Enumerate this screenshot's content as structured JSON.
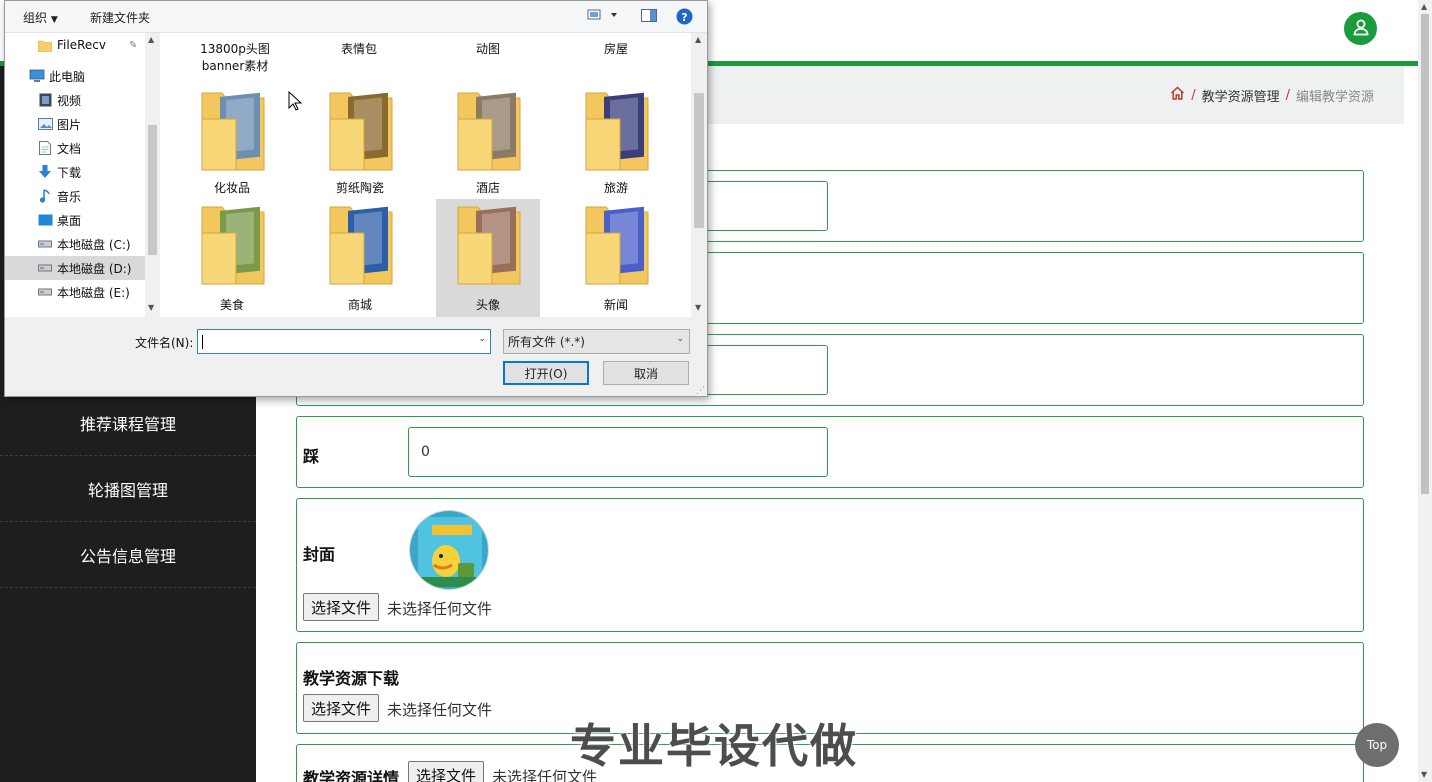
{
  "app": {
    "brand_color": "#1a9c3c",
    "user_icon": "user-icon"
  },
  "sidebar": {
    "items": [
      {
        "label": "推荐课程管理"
      },
      {
        "label": "轮播图管理"
      },
      {
        "label": "公告信息管理"
      }
    ]
  },
  "breadcrumb": {
    "home_icon": "home-icon",
    "items": [
      "教学资源管理",
      "编辑教学资源"
    ],
    "separator": "/"
  },
  "form": {
    "dislike": {
      "label": "踩",
      "value": "0"
    },
    "cover": {
      "label": "封面",
      "file_button": "选择文件",
      "file_status": "未选择任何文件"
    },
    "download": {
      "label": "教学资源下载",
      "file_button": "选择文件",
      "file_status": "未选择任何文件"
    },
    "detail": {
      "label": "教学资源详情",
      "file_button": "选择文件",
      "file_status": "未选择任何文件"
    }
  },
  "watermark": "专业毕设代做",
  "top_button": "Top",
  "dialog": {
    "toolbar": {
      "organize": "组织",
      "new_folder": "新建文件夹"
    },
    "nav": [
      {
        "label": "FileRecv",
        "icon": "folder-icon"
      },
      {
        "label": "此电脑",
        "icon": "computer-icon"
      },
      {
        "label": "视频",
        "icon": "video-icon"
      },
      {
        "label": "图片",
        "icon": "picture-icon"
      },
      {
        "label": "文档",
        "icon": "document-icon"
      },
      {
        "label": "下载",
        "icon": "download-icon"
      },
      {
        "label": "音乐",
        "icon": "music-icon"
      },
      {
        "label": "桌面",
        "icon": "desktop-icon"
      },
      {
        "label": "本地磁盘 (C:)",
        "icon": "drive-icon"
      },
      {
        "label": "本地磁盘 (D:)",
        "icon": "drive-icon"
      },
      {
        "label": "本地磁盘 (E:)",
        "icon": "drive-icon"
      }
    ],
    "folders_top": [
      "13800p头图banner素材",
      "表情包",
      "动图",
      "房屋"
    ],
    "folders": [
      {
        "label": "化妆品",
        "color": "#6d8fb3"
      },
      {
        "label": "剪纸陶瓷",
        "color": "#8a6a2e"
      },
      {
        "label": "酒店",
        "color": "#8c7a62"
      },
      {
        "label": "旅游",
        "color": "#3a3f7a"
      },
      {
        "label": "美食",
        "color": "#7a9a4a"
      },
      {
        "label": "商城",
        "color": "#2d5fa8"
      },
      {
        "label": "头像",
        "color": "#9a6f5a"
      },
      {
        "label": "新闻",
        "color": "#4a5fc8"
      }
    ],
    "filename_label": "文件名(N):",
    "filename_value": "",
    "filetype": "所有文件 (*.*)",
    "open_button": "打开(O)",
    "cancel_button": "取消"
  }
}
